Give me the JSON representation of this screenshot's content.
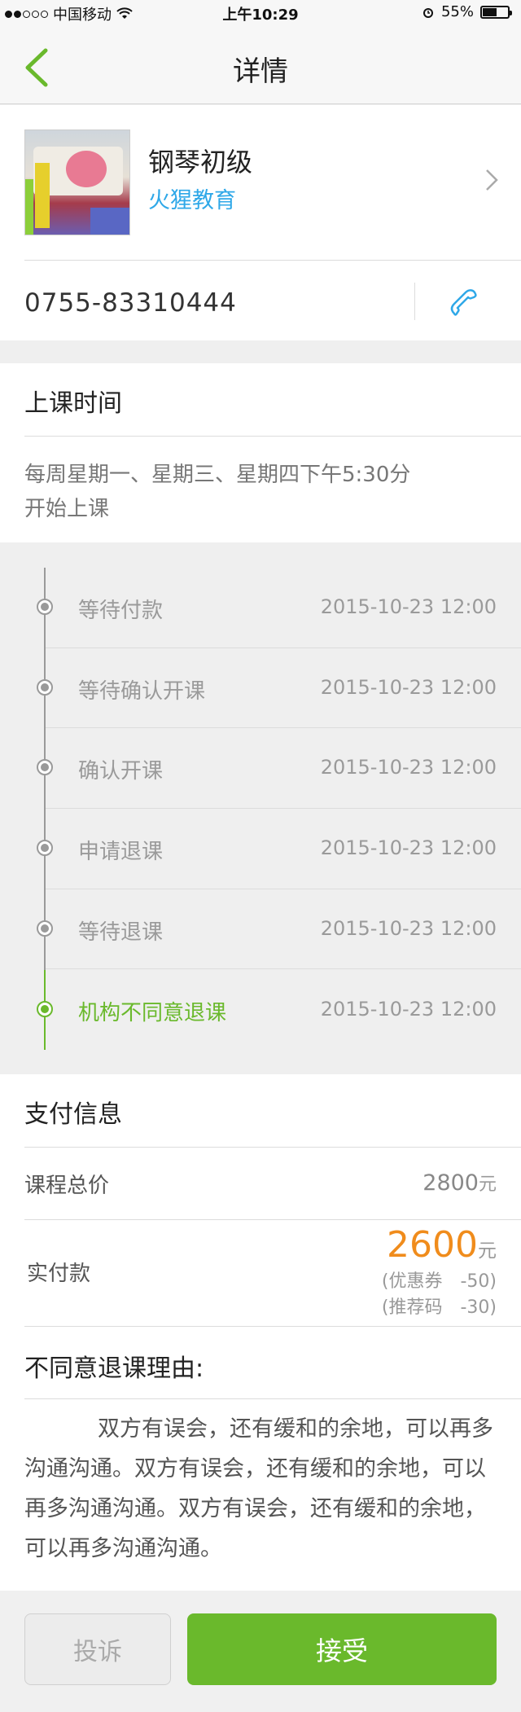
{
  "status_bar": {
    "carrier": "中国移动",
    "time": "上午10:29",
    "battery": "55%",
    "battery_level": 0.55,
    "signal_bars_filled": 2
  },
  "nav": {
    "title": "详情",
    "back_icon": "chevron-left-icon"
  },
  "course": {
    "name": "钢琴初级",
    "org": "火猩教育",
    "phone": "0755-83310444"
  },
  "schedule": {
    "title": "上课时间",
    "text_line1": "每周星期一、星期三、星期四下午5:30分",
    "text_line2": "开始上课"
  },
  "timeline": [
    {
      "label": "等待付款",
      "time": "2015-10-23 12:00",
      "active": false
    },
    {
      "label": "等待确认开课",
      "time": "2015-10-23 12:00",
      "active": false
    },
    {
      "label": "确认开课",
      "time": "2015-10-23 12:00",
      "active": false
    },
    {
      "label": "申请退课",
      "time": "2015-10-23 12:00",
      "active": false
    },
    {
      "label": "等待退课",
      "time": "2015-10-23 12:00",
      "active": false
    },
    {
      "label": "机构不同意退课",
      "time": "2015-10-23 12:00",
      "active": true
    }
  ],
  "payment": {
    "title": "支付信息",
    "total_label": "课程总价",
    "total_value": "2800",
    "unit": "元",
    "actual_label": "实付款",
    "actual_value": "2600",
    "discount1": "(优惠券　-50)",
    "discount2": "(推荐码　-30)"
  },
  "reason": {
    "title": "不同意退课理由:",
    "text": "双方有误会，还有缓和的余地，可以再多沟通沟通。双方有误会，还有缓和的余地，可以再多沟通沟通。双方有误会，还有缓和的余地，可以再多沟通沟通。"
  },
  "footer": {
    "complain_label": "投诉",
    "accept_label": "接受"
  },
  "colors": {
    "accent_green": "#6ab92c",
    "link_blue": "#2fa8e8",
    "price_orange": "#f08c1c"
  }
}
